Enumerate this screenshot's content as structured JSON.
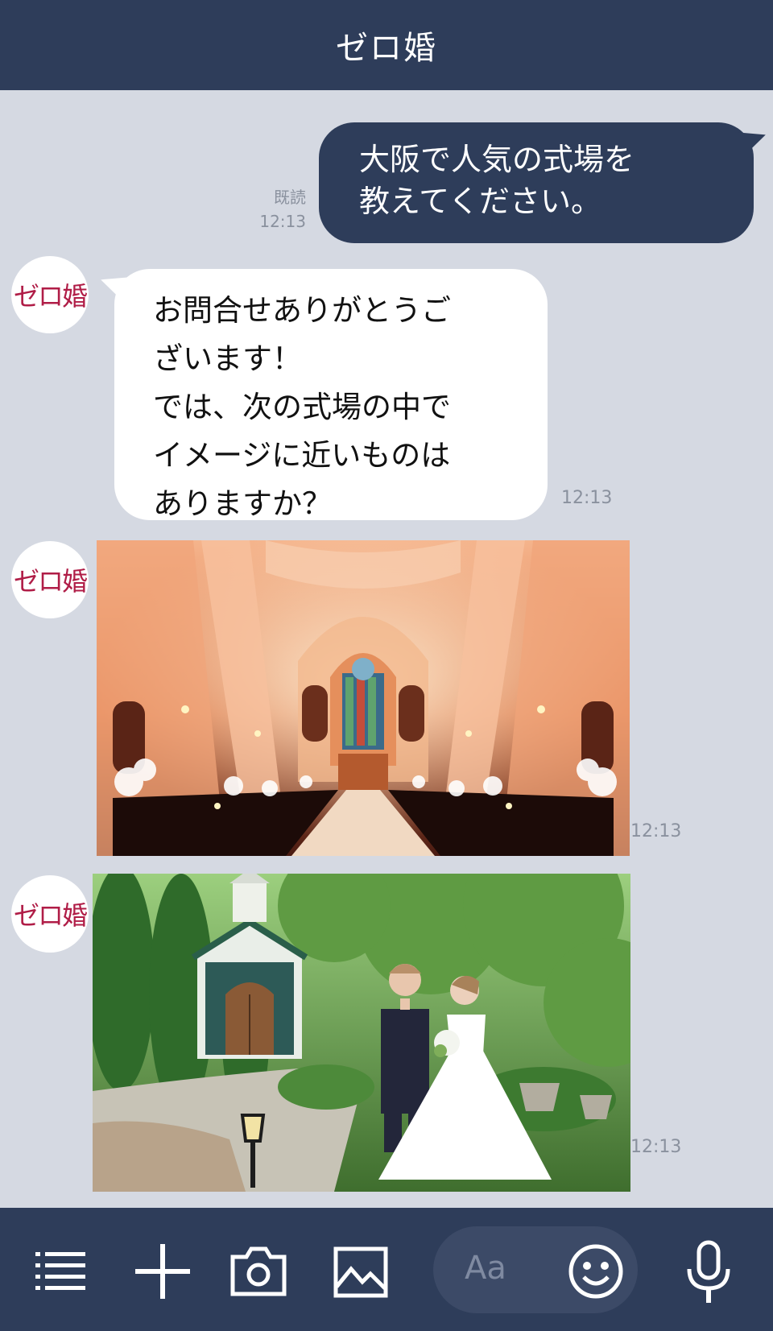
{
  "header": {
    "title": "ゼロ婚"
  },
  "avatar": {
    "label": "ゼロ婚"
  },
  "messages": {
    "outgoing": {
      "lines": [
        "大阪で人気の式場を",
        "教えてください。"
      ],
      "read_label": "既読",
      "time": "12:13"
    },
    "incoming_text": {
      "lines": [
        "お問合せありがとうご",
        "ざいます！",
        "では、次の式場の中で",
        "イメージに近いものは",
        "ありますか？"
      ],
      "time": "12:13"
    },
    "image1": {
      "alt": "church interior",
      "time": "12:13"
    },
    "image2": {
      "alt": "garden chapel with couple",
      "time": "12:13"
    }
  },
  "footer": {
    "input_placeholder": "Aa"
  },
  "icons": [
    "menu-icon",
    "plus-icon",
    "camera-icon",
    "image-icon",
    "emoji-icon",
    "microphone-icon"
  ],
  "colors": {
    "header_bg": "#2e3d5a",
    "chat_bg": "#d5d9e2",
    "brand_red": "#b01d47"
  }
}
